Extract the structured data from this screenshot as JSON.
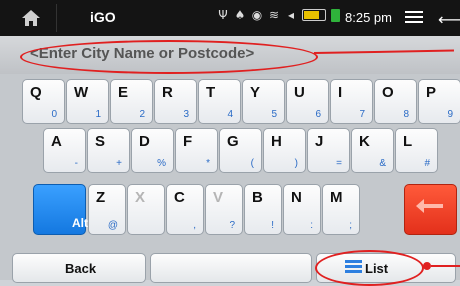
{
  "status_bar": {
    "app_name": "iGO",
    "time": "8:25 pm",
    "icons": [
      "home-icon",
      "usb-icon",
      "android-debug-icon",
      "gps-icon",
      "wifi-icon",
      "volume-icon",
      "battery-icon",
      "charging-icon",
      "menu-icon",
      "back-arrow-icon"
    ]
  },
  "search": {
    "placeholder": "<Enter City Name or Postcode>"
  },
  "keyboard": {
    "row1": [
      {
        "main": "Q",
        "sub": "0"
      },
      {
        "main": "W",
        "sub": "1"
      },
      {
        "main": "E",
        "sub": "2"
      },
      {
        "main": "R",
        "sub": "3"
      },
      {
        "main": "T",
        "sub": "4"
      },
      {
        "main": "Y",
        "sub": "5"
      },
      {
        "main": "U",
        "sub": "6"
      },
      {
        "main": "I",
        "sub": "7"
      },
      {
        "main": "O",
        "sub": "8"
      },
      {
        "main": "P",
        "sub": "9"
      }
    ],
    "row2": [
      {
        "main": "A",
        "sub": "-"
      },
      {
        "main": "S",
        "sub": "+"
      },
      {
        "main": "D",
        "sub": "%"
      },
      {
        "main": "F",
        "sub": "*"
      },
      {
        "main": "G",
        "sub": "("
      },
      {
        "main": "H",
        "sub": ")"
      },
      {
        "main": "J",
        "sub": "="
      },
      {
        "main": "K",
        "sub": "&"
      },
      {
        "main": "L",
        "sub": "#"
      }
    ],
    "row3": [
      {
        "main": "",
        "sub": "Alt"
      },
      {
        "main": "Z",
        "sub": "@"
      },
      {
        "main": "X",
        "sub": ""
      },
      {
        "main": "C",
        "sub": ","
      },
      {
        "main": "V",
        "sub": "?"
      },
      {
        "main": "B",
        "sub": "!"
      },
      {
        "main": "N",
        "sub": ":"
      },
      {
        "main": "M",
        "sub": ";"
      },
      {
        "main": "",
        "sub": ""
      }
    ],
    "back_label": "Back",
    "list_label": "List"
  },
  "colors": {
    "alt_key": "#1a82ee",
    "delete_key": "#ea3820",
    "annotation": "#e02020",
    "sub_label": "#2a6bc6"
  }
}
